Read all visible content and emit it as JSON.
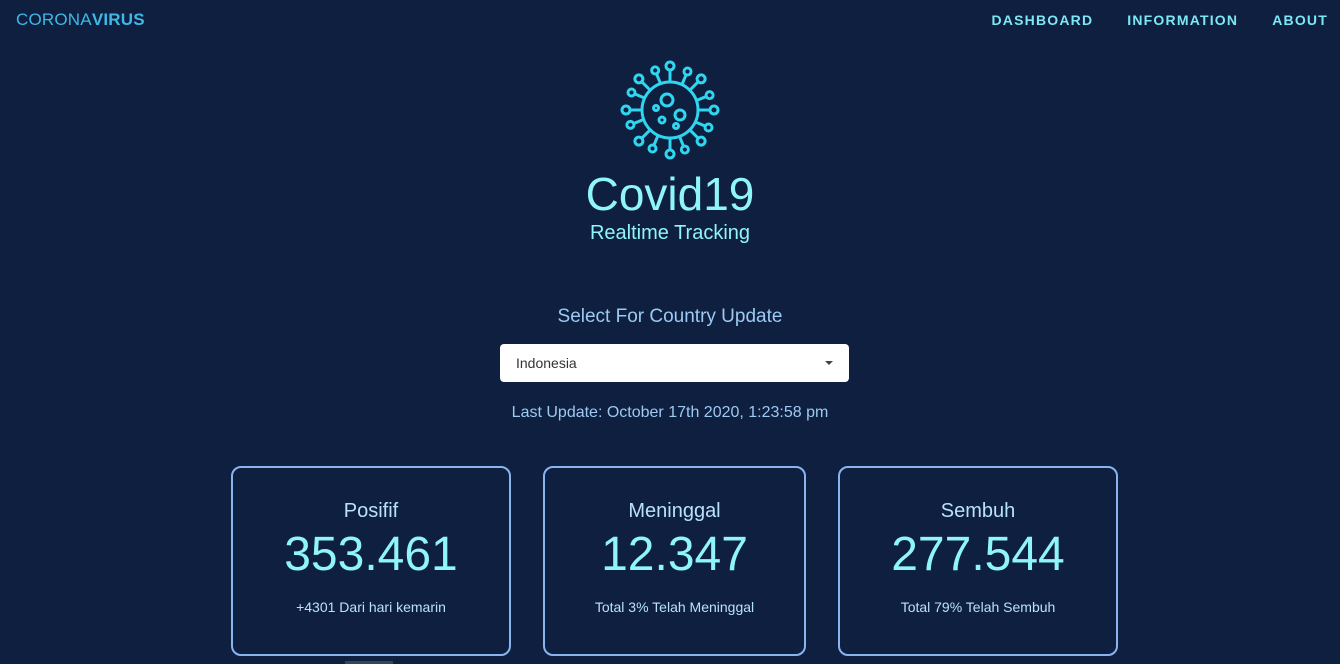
{
  "brand": {
    "light": "CORONA",
    "bold": "VIRUS"
  },
  "nav": {
    "items": [
      "DASHBOARD",
      "INFORMATION",
      "ABOUT"
    ]
  },
  "hero": {
    "title": "Covid19",
    "subtitle": "Realtime Tracking"
  },
  "selector": {
    "label": "Select For Country Update",
    "value": "Indonesia"
  },
  "last_update": "Last Update: October 17th 2020, 1:23:58 pm",
  "cards": [
    {
      "label": "Posifif",
      "value": "353.461",
      "note": "+4301 Dari hari kemarin"
    },
    {
      "label": "Meninggal",
      "value": "12.347",
      "note": "Total 3% Telah Meninggal"
    },
    {
      "label": "Sembuh",
      "value": "277.544",
      "note": "Total 79% Telah Sembuh"
    }
  ],
  "colors": {
    "background": "#0f1f3f",
    "accent": "#8ff5fb",
    "brand": "#3fb8e6",
    "card_border": "#8ab4f0"
  },
  "icons": {
    "hero": "virus-icon",
    "select_caret": "caret-down-icon"
  }
}
